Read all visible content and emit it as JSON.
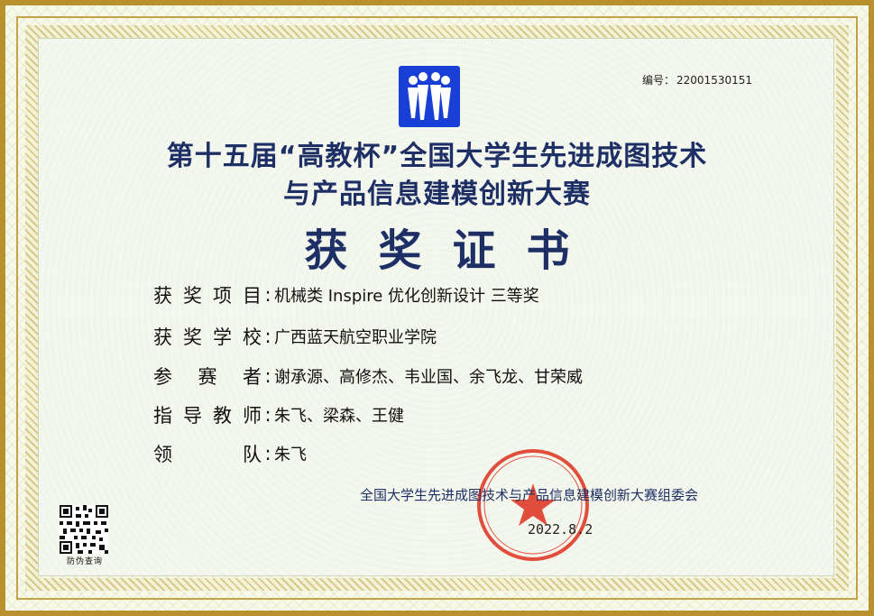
{
  "serial": {
    "label": "编号：",
    "number": "22001530151"
  },
  "title": {
    "line1": "第十五届“高教杯”全国大学生先进成图技术",
    "line2": "与产品信息建模创新大赛"
  },
  "certificate_title": "获奖证书",
  "fields": [
    {
      "label_chars": [
        "获",
        "奖",
        "项",
        "目"
      ],
      "value": "机械类 Inspire 优化创新设计  三等奖"
    },
    {
      "label_chars": [
        "获",
        "奖",
        "学",
        "校"
      ],
      "value": "广西蓝天航空职业学院"
    },
    {
      "label_chars": [
        "参",
        "赛",
        "者"
      ],
      "value": "谢承源、高修杰、韦业国、余飞龙、甘荣威"
    },
    {
      "label_chars": [
        "指",
        "导",
        "教",
        "师"
      ],
      "value": "朱飞、梁森、王健"
    },
    {
      "label_chars": [
        "领",
        "队"
      ],
      "value": "朱飞"
    }
  ],
  "colon": ":",
  "organizer": "全国大学生先进成图技术与产品信息建模创新大赛组委会",
  "date": "2022.8.2",
  "seal_text": "全国大学生先进成图技术与产品信息建模创新大赛组委会",
  "qr_label": "防伪查询",
  "colors": {
    "title": "#1e2f66",
    "logo": "#1a3fd6",
    "seal": "#e0311f",
    "border": "#b8912e"
  }
}
